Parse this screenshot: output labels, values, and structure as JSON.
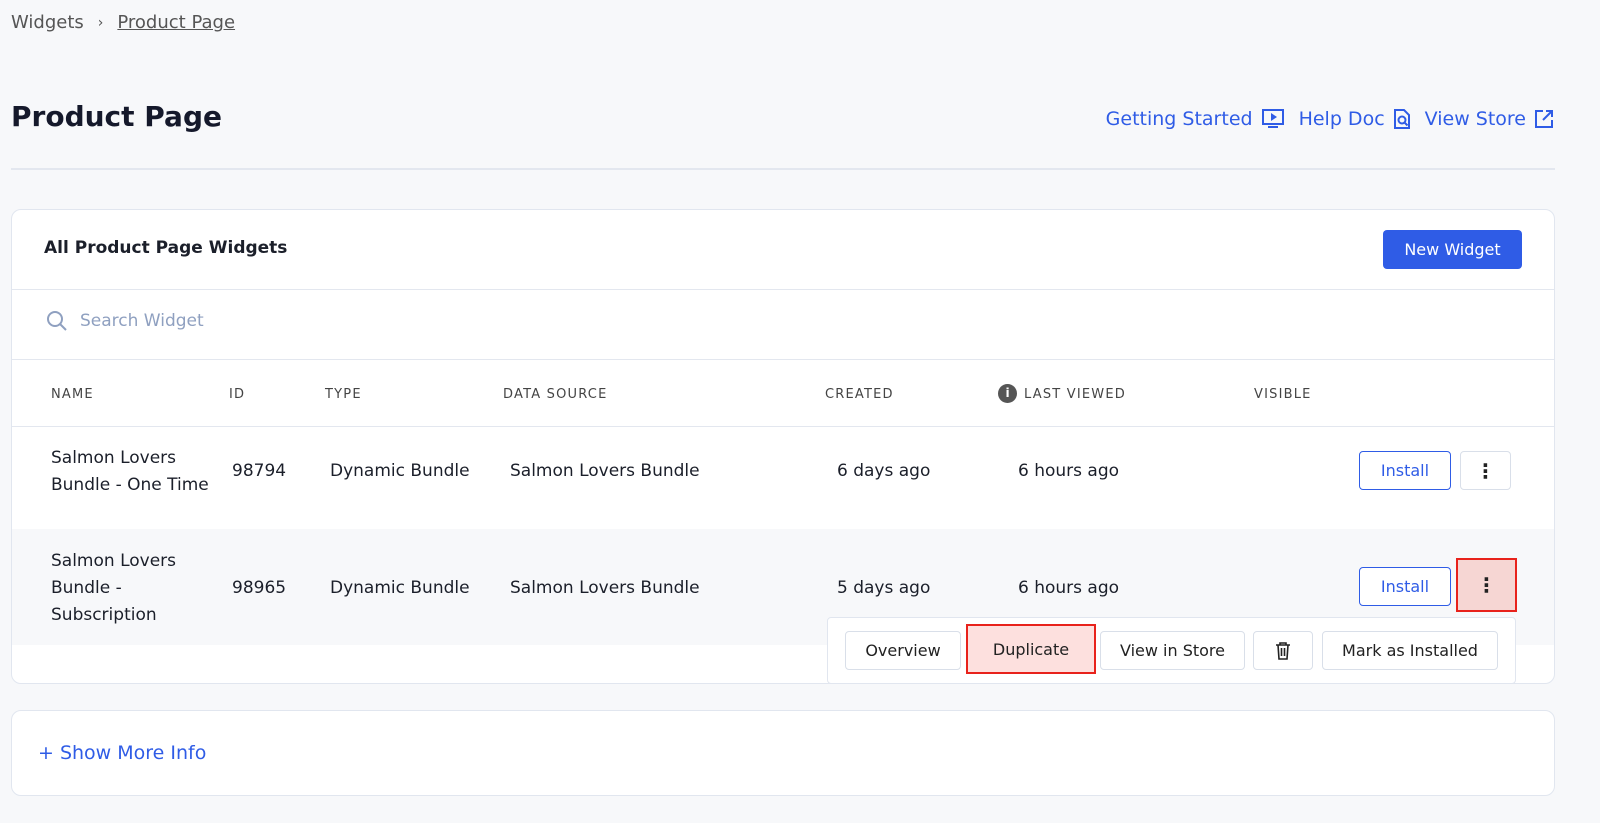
{
  "breadcrumb": {
    "items": [
      "Widgets",
      "Product Page"
    ],
    "separator": "›"
  },
  "page": {
    "title": "Product Page"
  },
  "header_links": [
    {
      "label": "Getting Started",
      "icon": "video-play-icon"
    },
    {
      "label": "Help Doc",
      "icon": "doc-search-icon"
    },
    {
      "label": "View Store",
      "icon": "external-link-icon"
    }
  ],
  "widgets_card": {
    "title": "All Product Page Widgets",
    "new_button": "New Widget",
    "search_placeholder": "Search Widget"
  },
  "table": {
    "columns": [
      "NAME",
      "ID",
      "TYPE",
      "DATA SOURCE",
      "CREATED",
      "LAST VIEWED",
      "VISIBLE"
    ],
    "rows": [
      {
        "name": "Salmon Lovers Bundle - One Time",
        "id": "98794",
        "type": "Dynamic Bundle",
        "source": "Salmon Lovers Bundle",
        "created": "6 days ago",
        "last_viewed": "6 hours ago",
        "action": "Install"
      },
      {
        "name": "Salmon Lovers Bundle - Subscription",
        "id": "98965",
        "type": "Dynamic Bundle",
        "source": "Salmon Lovers Bundle",
        "created": "5 days ago",
        "last_viewed": "6 hours ago",
        "action": "Install"
      }
    ]
  },
  "row_menu": {
    "overview": "Overview",
    "duplicate": "Duplicate",
    "view_in_store": "View in Store",
    "delete_icon": "trash-icon",
    "mark_installed": "Mark as Installed"
  },
  "footer": {
    "show_more": "+ Show More Info"
  },
  "colors": {
    "accent": "#2f5ce6",
    "highlight": "#e8221b"
  }
}
